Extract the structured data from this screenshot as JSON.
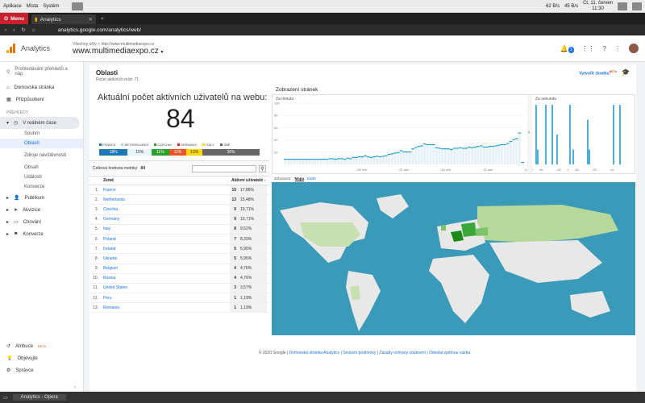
{
  "desktop": {
    "menus": [
      "Aplikace",
      "Místa",
      "Systém"
    ],
    "net_down": "62 B/s",
    "net_up": "45 B/s",
    "date": "Čt, 11. červen",
    "time": "11:30"
  },
  "browser": {
    "menu_label": "Menu",
    "tab_title": "Analytics",
    "url": "analytics.google.com/analytics/web/"
  },
  "app": {
    "brand": "Analytics",
    "account_path": "Všechny účty > http://www.multimediaexpo.cz",
    "property": "www.multimediaexpo.cz",
    "notif_count": "1"
  },
  "sidebar": {
    "search_placeholder": "Prohledávání přehledů a náp",
    "home": "Domovská stránka",
    "customization": "Přizpůsobení",
    "reports_section": "PŘEHLEDY",
    "realtime": "V reálném čase",
    "realtime_items": [
      "Souhrn",
      "Oblasti",
      "Zdroje návštěvnosti",
      "Obsah",
      "Události",
      "Konverze"
    ],
    "audience": "Publikum",
    "acquisition": "Akvizice",
    "behavior": "Chování",
    "conversions": "Konverze",
    "attribution": "Atribuce",
    "beta": "BETA",
    "discover": "Objevujte",
    "admin": "Správce"
  },
  "page": {
    "title": "Oblasti",
    "subtitle": "Počet aktivních míst: 71",
    "create_shortcut": "Vytvořit zkratku",
    "active_title": "Aktuální počet aktivních uživatelů na webu:",
    "active_count": "84",
    "legend": [
      {
        "label": "FRANCE",
        "color": "#1f77b4"
      },
      {
        "label": "NETHERLANDS",
        "color": "#9edae5"
      },
      {
        "label": "CZECHIA",
        "color": "#2ca02c"
      },
      {
        "label": "GERMANY",
        "color": "#d62728"
      },
      {
        "label": "ITALY",
        "color": "#ffd700"
      },
      {
        "label": "JINÉ",
        "color": "#666666"
      }
    ],
    "share_bar": [
      {
        "label": "18%",
        "value": 18,
        "color": "#1f77b4"
      },
      {
        "label": "15%",
        "value": 15,
        "color": "#e8f4fb"
      },
      {
        "label": "11%",
        "value": 11,
        "color": "#2ca02c"
      },
      {
        "label": "11%",
        "value": 11,
        "color": "#e8552a"
      },
      {
        "label": "10%",
        "value": 10,
        "color": "#ffd700"
      },
      {
        "label": "36%",
        "value": 36,
        "color": "#666666"
      }
    ],
    "total_metric_label": "Celková hodnota metriky:",
    "total_metric_value": "84",
    "table": {
      "col_country": "Země",
      "col_users": "Aktivní uživatelé",
      "rows": [
        {
          "n": "1.",
          "country": "France",
          "users": "15",
          "pct": "17,86%"
        },
        {
          "n": "2.",
          "country": "Netherlands",
          "users": "13",
          "pct": "15,48%"
        },
        {
          "n": "3.",
          "country": "Czechia",
          "users": "9",
          "pct": "10,71%"
        },
        {
          "n": "4.",
          "country": "Germany",
          "users": "9",
          "pct": "10,71%"
        },
        {
          "n": "5.",
          "country": "Italy",
          "users": "8",
          "pct": "9,52%"
        },
        {
          "n": "6.",
          "country": "Poland",
          "users": "7",
          "pct": "8,33%"
        },
        {
          "n": "7.",
          "country": "Ireland",
          "users": "5",
          "pct": "5,95%"
        },
        {
          "n": "8.",
          "country": "Ukraine",
          "users": "5",
          "pct": "5,95%"
        },
        {
          "n": "9.",
          "country": "Belgium",
          "users": "4",
          "pct": "4,76%"
        },
        {
          "n": "10.",
          "country": "Russia",
          "users": "4",
          "pct": "4,76%"
        },
        {
          "n": "11.",
          "country": "United States",
          "users": "3",
          "pct": "3,57%"
        },
        {
          "n": "12.",
          "country": "Peru",
          "users": "1",
          "pct": "1,19%"
        },
        {
          "n": "13.",
          "country": "Romania",
          "users": "1",
          "pct": "1,19%"
        }
      ]
    },
    "pageviews_title": "Zobrazení stránek",
    "per_minute": "Za minutu",
    "per_second": "Za sekundu",
    "minute_yticks": [
      "100",
      "80",
      "60",
      "40",
      "20"
    ],
    "minute_xticks": [
      "-26 min",
      "-21 min",
      "-16 min",
      "-11 min",
      "-6 min",
      "-1"
    ],
    "second_xticks": [
      "-50",
      "-40",
      "-30",
      "-20",
      "-10"
    ],
    "view_label": "Zobrazení:",
    "view_map": "Mapa",
    "view_earth": "Earth"
  },
  "chart_data": [
    {
      "type": "bar",
      "title": "Za minutu",
      "ylim": [
        0,
        100
      ],
      "values": [
        9,
        9,
        9,
        9,
        9,
        9,
        9,
        9,
        9,
        9,
        9,
        9,
        9,
        9,
        9,
        10,
        10,
        9,
        10,
        10,
        9,
        11,
        10,
        12,
        12,
        13,
        13,
        15,
        13,
        12,
        13,
        14,
        13,
        14,
        15,
        17,
        18,
        19,
        20,
        23,
        21,
        21,
        21,
        26,
        28,
        30,
        31,
        34,
        33,
        33,
        33,
        28,
        27,
        26,
        26,
        26,
        25,
        27,
        27,
        28,
        27,
        27,
        29,
        28,
        29,
        30,
        31,
        29,
        29,
        30,
        30,
        31,
        32,
        33,
        33,
        35,
        38,
        41,
        43,
        52,
        4
      ]
    },
    {
      "type": "bar",
      "title": "Za sekundu",
      "values": [
        4,
        1,
        0,
        0,
        0,
        0,
        4,
        0,
        0,
        0,
        4,
        0,
        0,
        2,
        0,
        0,
        0,
        0,
        0,
        0,
        0,
        4,
        0,
        1,
        0,
        0,
        0,
        0,
        0,
        0,
        0,
        0,
        3,
        1,
        0,
        0,
        0,
        0,
        0,
        0,
        0,
        0,
        0,
        0,
        0,
        0,
        0,
        0,
        4,
        0,
        0,
        0,
        4,
        0,
        0,
        0,
        0,
        0,
        0,
        0
      ]
    }
  ],
  "footer": {
    "copyright": "© 2020 Google",
    "links": [
      "Domovská stránka Analytics",
      "Smluvní podmínky",
      "Zásady ochrany soukromí",
      "Odeslat zpětnou vazbu"
    ]
  },
  "taskbar": {
    "window": "Analytics - Opera"
  }
}
